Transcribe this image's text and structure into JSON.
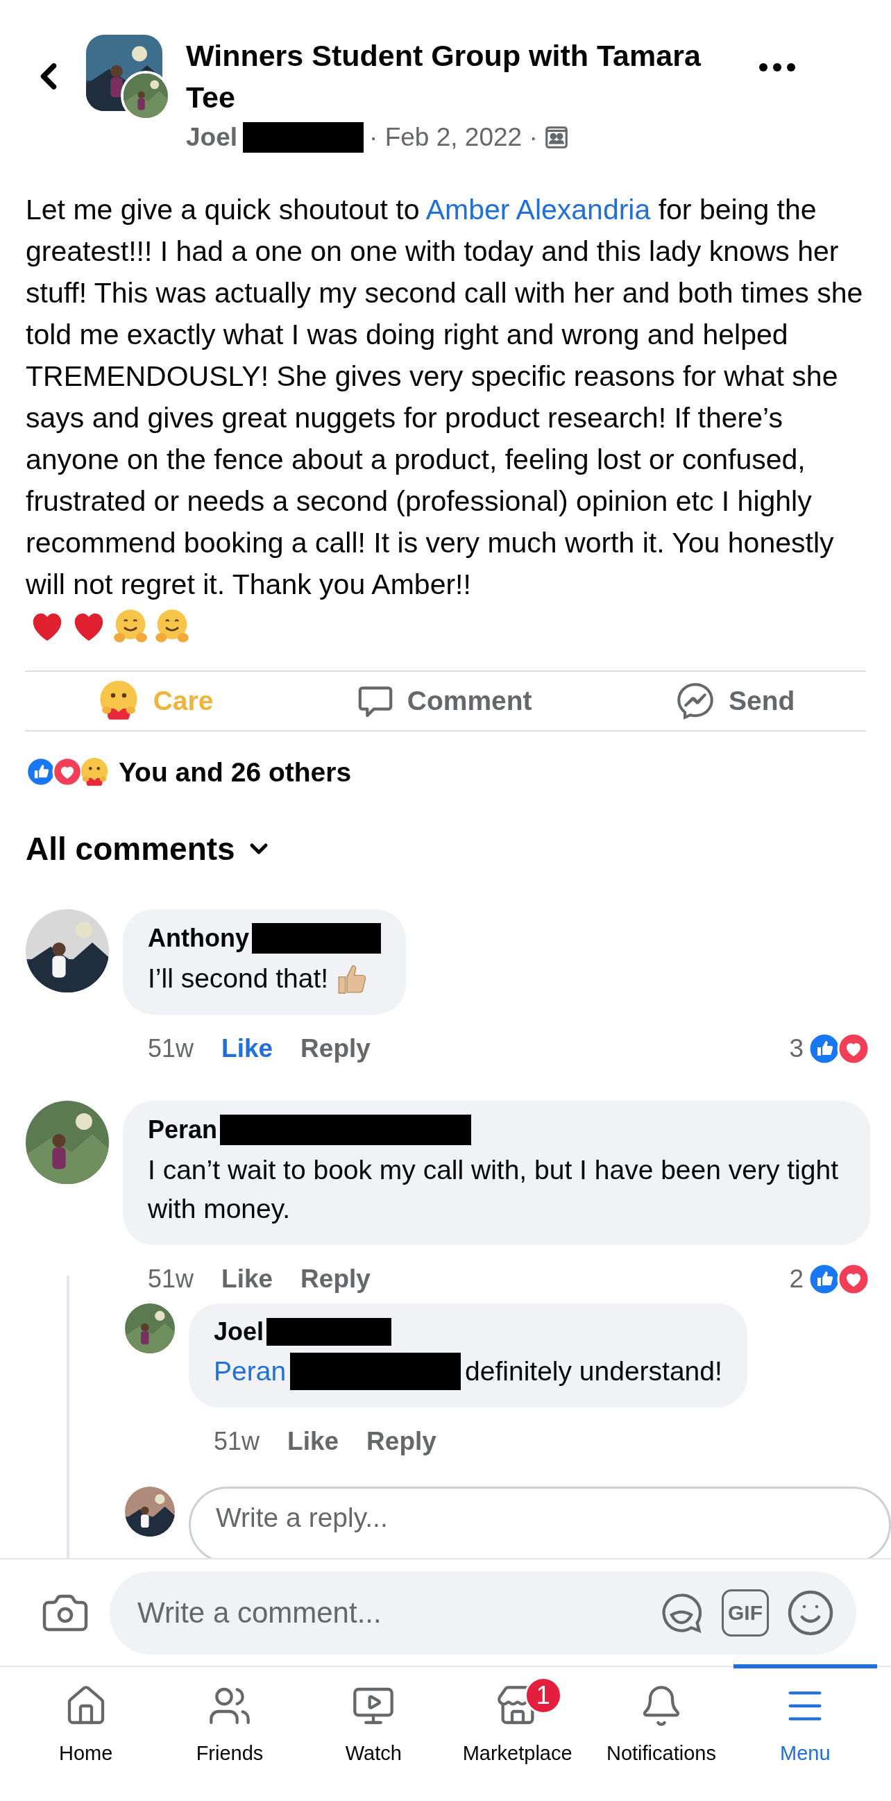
{
  "header": {
    "group_name": "Winners Student Group with Tamara Tee",
    "author": "Joel",
    "author_redacted": true,
    "date": "· Feb 2, 2022 ·"
  },
  "post": {
    "segments": [
      {
        "kind": "plain",
        "text": "Let me give a quick shoutout to "
      },
      {
        "kind": "link",
        "text": "Amber Alexandria"
      },
      {
        "kind": "plain",
        "text": " for being the greatest!!! I had a one on one with today and this lady knows her stuff! This was actually my second call with her and both times she told me exactly what I was doing right and wrong and helped TREMENDOUSLY! She gives very specific reasons for what she says and gives great nuggets for product research! If there’s anyone on the fence about a product, feeling lost or confused, frustrated or needs a second (professional) opinion etc I highly recommend booking a call! It is very much worth it. You honestly will not regret it. Thank you Amber!!"
      }
    ]
  },
  "actions": [
    {
      "kind": "care",
      "label": "Care",
      "selected": true
    },
    {
      "kind": "comment",
      "label": "Comment",
      "selected": false
    },
    {
      "kind": "send",
      "label": "Send",
      "selected": false
    }
  ],
  "reactions_summary": "You and 26 others",
  "comments_heading": "All comments",
  "comments": [
    {
      "author": "Anthony",
      "author_redacted": true,
      "text": "I’ll second that!",
      "emoji": true,
      "time": "51w",
      "like_label": "Like",
      "liked": true,
      "reply_label": "Reply",
      "reaction_count": "3"
    },
    {
      "author": "Peran",
      "author_redacted": true,
      "text": "I can’t wait to book my call with, but I have been very tight with money.",
      "emoji": false,
      "time": "51w",
      "like_label": "Like",
      "liked": false,
      "reply_label": "Reply",
      "reaction_count": "2",
      "replies": [
        {
          "author": "Joel",
          "author_redacted": true,
          "mention": "Peran",
          "mention_redacted": true,
          "text": "definitely understand!",
          "time": "51w",
          "like_label": "Like",
          "liked": false,
          "reply_label": "Reply"
        }
      ]
    }
  ],
  "reply_field": {
    "placeholder": "Write a reply..."
  },
  "composer": {
    "placeholder": "Write a comment...",
    "gif_label": "GIF"
  },
  "tabs": [
    {
      "kind": "home",
      "label": "Home",
      "selected": false
    },
    {
      "kind": "friends",
      "label": "Friends",
      "selected": false
    },
    {
      "kind": "watch",
      "label": "Watch",
      "selected": false
    },
    {
      "kind": "marketplace",
      "label": "Marketplace",
      "selected": false,
      "badge": "1"
    },
    {
      "kind": "notifications",
      "label": "Notifications",
      "selected": false
    },
    {
      "kind": "menu",
      "label": "Menu",
      "selected": true
    }
  ]
}
